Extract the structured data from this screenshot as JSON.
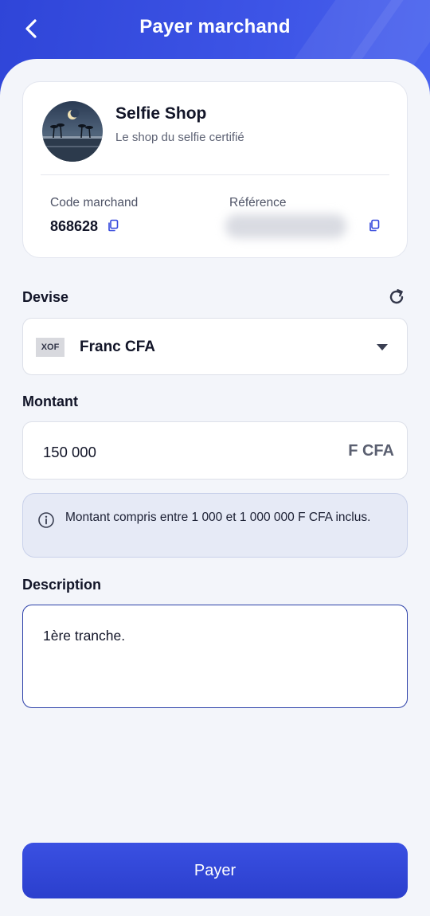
{
  "header": {
    "title": "Payer marchand",
    "back_icon": "chevron-left-icon"
  },
  "merchant": {
    "name": "Selfie Shop",
    "tagline": "Le shop du selfie certifié",
    "code_label": "Code marchand",
    "code_value": "868628",
    "reference_label": "Référence",
    "copy_icon": "copy-icon"
  },
  "currency": {
    "label": "Devise",
    "refresh_icon": "refresh-icon",
    "code": "XOF",
    "name": "Franc CFA",
    "dropdown_icon": "caret-down-icon"
  },
  "amount": {
    "label": "Montant",
    "value": "150 000",
    "unit": "F CFA",
    "info_icon": "info-icon",
    "info_text": "Montant compris entre 1 000  et 1 000 000  F CFA inclus."
  },
  "description": {
    "label": "Description",
    "value": "1ère tranche."
  },
  "pay_button": {
    "label": "Payer"
  },
  "colors": {
    "primary": "#3347dc",
    "background": "#f3f5fa",
    "info_bg": "#e6eaf6",
    "focus_border": "#2b3fa8"
  }
}
